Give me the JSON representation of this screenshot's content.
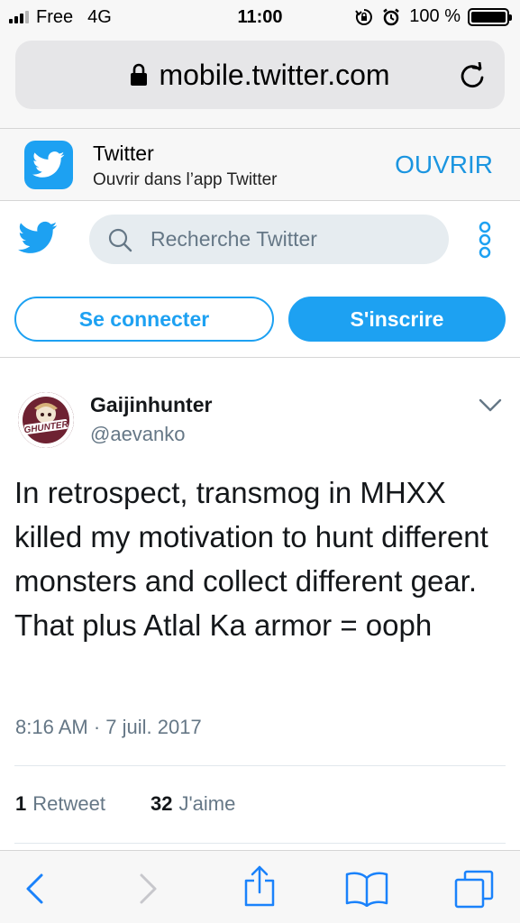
{
  "status_bar": {
    "carrier": "Free",
    "network": "4G",
    "time": "11:00",
    "battery": "100 %",
    "battery_level": 1.0
  },
  "browser": {
    "url": "mobile.twitter.com"
  },
  "app_banner": {
    "title": "Twitter",
    "subtitle": "Ouvrir dans l’app Twitter",
    "open_label": "OUVRIR"
  },
  "header": {
    "search_placeholder": "Recherche Twitter"
  },
  "auth": {
    "login_label": "Se connecter",
    "signup_label": "S'inscrire"
  },
  "tweet": {
    "author_name": "Gaijinhunter",
    "author_handle": "@aevanko",
    "text": "In retrospect, transmog in MHXX killed my motivation to hunt different monsters and collect different gear. That plus Atlal Ka armor = ooph",
    "timestamp": "8:16 AM · 7 juil. 2017",
    "retweets_count": "1",
    "retweets_label": "Retweet",
    "likes_count": "32",
    "likes_label": "J'aime"
  },
  "colors": {
    "twitter_blue": "#1da1f2",
    "link_blue": "#1b95e0",
    "secondary_text": "#657786",
    "toolbar_blue": "#1a82fb"
  }
}
